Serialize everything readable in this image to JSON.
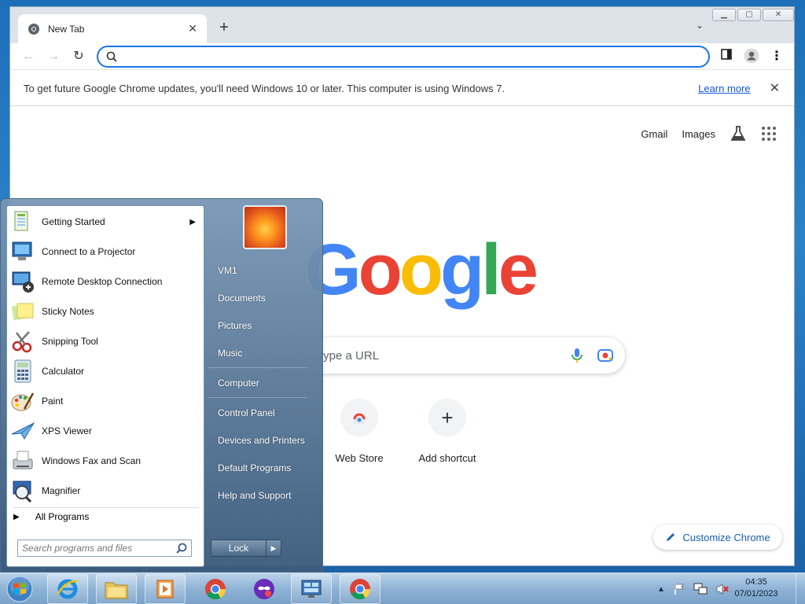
{
  "browser": {
    "tab_title": "New Tab",
    "omnibox_value": "",
    "infobar": {
      "message": "To get future Google Chrome updates, you'll need Windows 10 or later. This computer is using Windows 7.",
      "link": "Learn more"
    },
    "ntp": {
      "top_links": [
        "Gmail",
        "Images"
      ],
      "logo_letters": [
        {
          "ch": "G",
          "color": "#4285f4"
        },
        {
          "ch": "o",
          "color": "#ea4335"
        },
        {
          "ch": "o",
          "color": "#fbbc05"
        },
        {
          "ch": "g",
          "color": "#4285f4"
        },
        {
          "ch": "l",
          "color": "#34a853"
        },
        {
          "ch": "e",
          "color": "#ea4335"
        }
      ],
      "search_placeholder": "type a URL",
      "shortcuts": [
        {
          "label": "Web Store",
          "icon": "chrome-web-store-icon"
        },
        {
          "label": "Add shortcut",
          "icon": "plus-icon"
        }
      ],
      "customize_label": "Customize Chrome"
    }
  },
  "start_menu": {
    "programs": [
      {
        "label": "Getting Started",
        "icon": "getting-started-icon",
        "submenu": true
      },
      {
        "label": "Connect to a Projector",
        "icon": "projector-icon"
      },
      {
        "label": "Remote Desktop Connection",
        "icon": "remote-desktop-icon"
      },
      {
        "label": "Sticky Notes",
        "icon": "sticky-notes-icon"
      },
      {
        "label": "Snipping Tool",
        "icon": "snipping-tool-icon"
      },
      {
        "label": "Calculator",
        "icon": "calculator-icon"
      },
      {
        "label": "Paint",
        "icon": "paint-icon"
      },
      {
        "label": "XPS Viewer",
        "icon": "xps-viewer-icon"
      },
      {
        "label": "Windows Fax and Scan",
        "icon": "fax-scan-icon"
      },
      {
        "label": "Magnifier",
        "icon": "magnifier-icon"
      }
    ],
    "all_programs": "All Programs",
    "search_placeholder": "Search programs and files",
    "right_items": [
      "VM1",
      "Documents",
      "Pictures",
      "Music",
      "Computer",
      "Control Panel",
      "Devices and Printers",
      "Default Programs",
      "Help and Support"
    ],
    "lock_label": "Lock"
  },
  "taskbar": {
    "pinned": [
      "internet-explorer-icon",
      "windows-explorer-icon",
      "media-player-icon",
      "chrome-icon",
      "privacy-app-icon",
      "remote-console-icon",
      "chrome-icon"
    ],
    "time": "04:35",
    "date": "07/01/2023"
  }
}
